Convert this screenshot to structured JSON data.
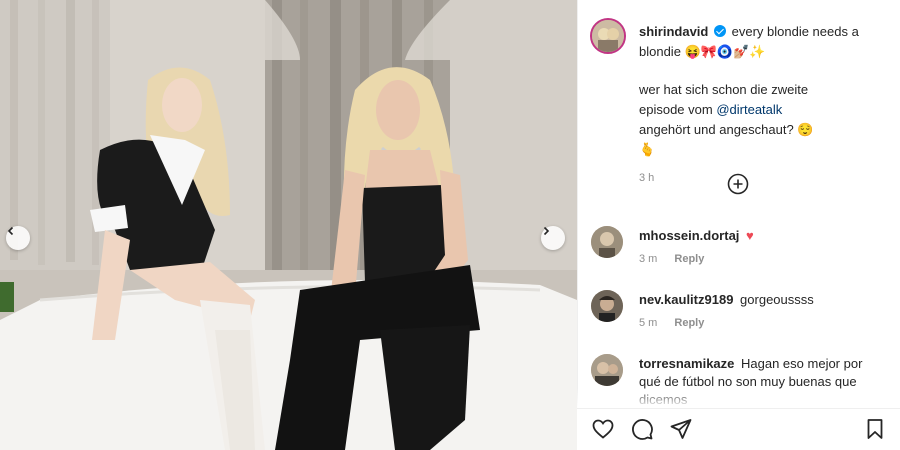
{
  "post": {
    "author": "shirindavid",
    "caption_line1": "every blondie needs a",
    "caption_line2": "blondie 😝🎀🧿💅🏼✨",
    "caption_para2_part1": "wer hat sich schon die zweite episode vom",
    "caption_mention": "@dirteatalk",
    "caption_para2_part2": "angehört und angeschaut? 😌🫰",
    "timestamp": "3 h"
  },
  "comments": [
    {
      "username": "mhossein.dortaj",
      "text": "♥",
      "time": "3 m",
      "reply": "Reply",
      "heart_color": "#ed4956"
    },
    {
      "username": "nev.kaulitz9189",
      "text": "gorgeoussss",
      "time": "5 m",
      "reply": "Reply"
    },
    {
      "username": "torresnamikaze",
      "text": "Hagan eso mejor por qué de fútbol no son muy buenas que dicemos",
      "time": "",
      "reply": ""
    }
  ],
  "icons": {
    "load_more": "plus-circle-icon",
    "like": "heart-icon",
    "comment": "comment-icon",
    "share": "paper-plane-icon",
    "save": "bookmark-icon",
    "prev": "chevron-left-icon",
    "next": "chevron-right-icon"
  },
  "colors": {
    "verified": "#0095f6",
    "mention": "#00376b",
    "meta": "#8e8e8e"
  }
}
